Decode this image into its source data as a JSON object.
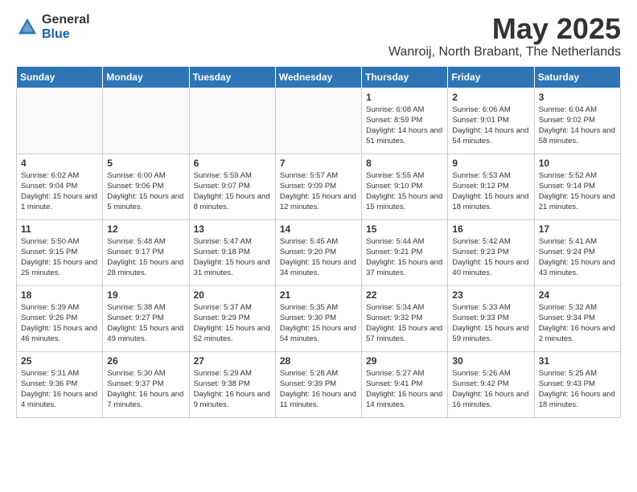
{
  "logo": {
    "general": "General",
    "blue": "Blue"
  },
  "header": {
    "month": "May 2025",
    "location": "Wanroij, North Brabant, The Netherlands"
  },
  "weekdays": [
    "Sunday",
    "Monday",
    "Tuesday",
    "Wednesday",
    "Thursday",
    "Friday",
    "Saturday"
  ],
  "weeks": [
    [
      {
        "day": "",
        "info": ""
      },
      {
        "day": "",
        "info": ""
      },
      {
        "day": "",
        "info": ""
      },
      {
        "day": "",
        "info": ""
      },
      {
        "day": "1",
        "info": "Sunrise: 6:08 AM\nSunset: 8:59 PM\nDaylight: 14 hours\nand 51 minutes."
      },
      {
        "day": "2",
        "info": "Sunrise: 6:06 AM\nSunset: 9:01 PM\nDaylight: 14 hours\nand 54 minutes."
      },
      {
        "day": "3",
        "info": "Sunrise: 6:04 AM\nSunset: 9:02 PM\nDaylight: 14 hours\nand 58 minutes."
      }
    ],
    [
      {
        "day": "4",
        "info": "Sunrise: 6:02 AM\nSunset: 9:04 PM\nDaylight: 15 hours\nand 1 minute."
      },
      {
        "day": "5",
        "info": "Sunrise: 6:00 AM\nSunset: 9:06 PM\nDaylight: 15 hours\nand 5 minutes."
      },
      {
        "day": "6",
        "info": "Sunrise: 5:59 AM\nSunset: 9:07 PM\nDaylight: 15 hours\nand 8 minutes."
      },
      {
        "day": "7",
        "info": "Sunrise: 5:57 AM\nSunset: 9:09 PM\nDaylight: 15 hours\nand 12 minutes."
      },
      {
        "day": "8",
        "info": "Sunrise: 5:55 AM\nSunset: 9:10 PM\nDaylight: 15 hours\nand 15 minutes."
      },
      {
        "day": "9",
        "info": "Sunrise: 5:53 AM\nSunset: 9:12 PM\nDaylight: 15 hours\nand 18 minutes."
      },
      {
        "day": "10",
        "info": "Sunrise: 5:52 AM\nSunset: 9:14 PM\nDaylight: 15 hours\nand 21 minutes."
      }
    ],
    [
      {
        "day": "11",
        "info": "Sunrise: 5:50 AM\nSunset: 9:15 PM\nDaylight: 15 hours\nand 25 minutes."
      },
      {
        "day": "12",
        "info": "Sunrise: 5:48 AM\nSunset: 9:17 PM\nDaylight: 15 hours\nand 28 minutes."
      },
      {
        "day": "13",
        "info": "Sunrise: 5:47 AM\nSunset: 9:18 PM\nDaylight: 15 hours\nand 31 minutes."
      },
      {
        "day": "14",
        "info": "Sunrise: 5:45 AM\nSunset: 9:20 PM\nDaylight: 15 hours\nand 34 minutes."
      },
      {
        "day": "15",
        "info": "Sunrise: 5:44 AM\nSunset: 9:21 PM\nDaylight: 15 hours\nand 37 minutes."
      },
      {
        "day": "16",
        "info": "Sunrise: 5:42 AM\nSunset: 9:23 PM\nDaylight: 15 hours\nand 40 minutes."
      },
      {
        "day": "17",
        "info": "Sunrise: 5:41 AM\nSunset: 9:24 PM\nDaylight: 15 hours\nand 43 minutes."
      }
    ],
    [
      {
        "day": "18",
        "info": "Sunrise: 5:39 AM\nSunset: 9:26 PM\nDaylight: 15 hours\nand 46 minutes."
      },
      {
        "day": "19",
        "info": "Sunrise: 5:38 AM\nSunset: 9:27 PM\nDaylight: 15 hours\nand 49 minutes."
      },
      {
        "day": "20",
        "info": "Sunrise: 5:37 AM\nSunset: 9:29 PM\nDaylight: 15 hours\nand 52 minutes."
      },
      {
        "day": "21",
        "info": "Sunrise: 5:35 AM\nSunset: 9:30 PM\nDaylight: 15 hours\nand 54 minutes."
      },
      {
        "day": "22",
        "info": "Sunrise: 5:34 AM\nSunset: 9:32 PM\nDaylight: 15 hours\nand 57 minutes."
      },
      {
        "day": "23",
        "info": "Sunrise: 5:33 AM\nSunset: 9:33 PM\nDaylight: 15 hours\nand 59 minutes."
      },
      {
        "day": "24",
        "info": "Sunrise: 5:32 AM\nSunset: 9:34 PM\nDaylight: 16 hours\nand 2 minutes."
      }
    ],
    [
      {
        "day": "25",
        "info": "Sunrise: 5:31 AM\nSunset: 9:36 PM\nDaylight: 16 hours\nand 4 minutes."
      },
      {
        "day": "26",
        "info": "Sunrise: 5:30 AM\nSunset: 9:37 PM\nDaylight: 16 hours\nand 7 minutes."
      },
      {
        "day": "27",
        "info": "Sunrise: 5:29 AM\nSunset: 9:38 PM\nDaylight: 16 hours\nand 9 minutes."
      },
      {
        "day": "28",
        "info": "Sunrise: 5:28 AM\nSunset: 9:39 PM\nDaylight: 16 hours\nand 11 minutes."
      },
      {
        "day": "29",
        "info": "Sunrise: 5:27 AM\nSunset: 9:41 PM\nDaylight: 16 hours\nand 14 minutes."
      },
      {
        "day": "30",
        "info": "Sunrise: 5:26 AM\nSunset: 9:42 PM\nDaylight: 16 hours\nand 16 minutes."
      },
      {
        "day": "31",
        "info": "Sunrise: 5:25 AM\nSunset: 9:43 PM\nDaylight: 16 hours\nand 18 minutes."
      }
    ]
  ]
}
